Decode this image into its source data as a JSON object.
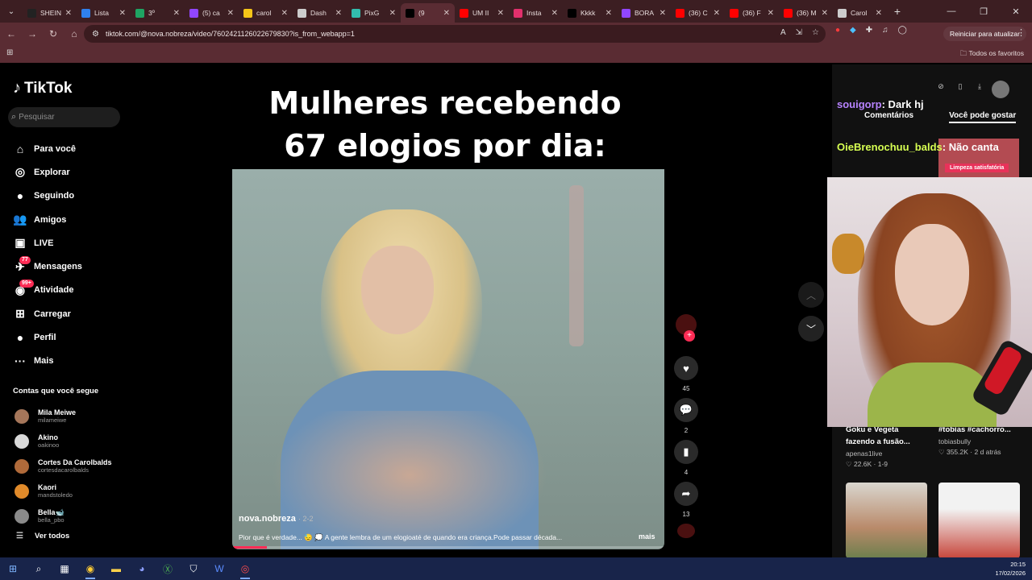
{
  "browser": {
    "tabs": [
      {
        "title": "SHEIN",
        "favicon": "S",
        "color": "#222222"
      },
      {
        "title": "Lista",
        "favicon": "cloud",
        "color": "#2f80ed"
      },
      {
        "title": "3º",
        "favicon": "drive",
        "color": "#1fa463"
      },
      {
        "title": "(5) ca",
        "favicon": "twitch",
        "color": "#9146ff"
      },
      {
        "title": "carol",
        "favicon": "c",
        "color": "#f5c518"
      },
      {
        "title": "Dash",
        "favicon": "globe",
        "color": "#cccccc"
      },
      {
        "title": "PixG",
        "favicon": "pix",
        "color": "#32bcad"
      },
      {
        "title": "(9",
        "favicon": "tiktok",
        "color": "#000000",
        "active": true
      },
      {
        "title": "UM II",
        "favicon": "youtube",
        "color": "#ff0000"
      },
      {
        "title": "Insta",
        "favicon": "instagram",
        "color": "#e1306c"
      },
      {
        "title": "Kkkk",
        "favicon": "tiktok",
        "color": "#000000"
      },
      {
        "title": "BORA",
        "favicon": "twitch",
        "color": "#9146ff"
      },
      {
        "title": "(36) C",
        "favicon": "youtube",
        "color": "#ff0000"
      },
      {
        "title": "(36) F",
        "favicon": "youtube",
        "color": "#ff0000"
      },
      {
        "title": "(36) M",
        "favicon": "youtube",
        "color": "#ff0000"
      },
      {
        "title": "Carol",
        "favicon": "globe",
        "color": "#cccccc"
      }
    ],
    "url": "tiktok.com/@nova.nobreza/video/7602421126022679830?is_from_webapp=1",
    "restart_label": "Reiniciar para atualizar",
    "all_favorites_label": "Todos os favoritos",
    "accent": "#5a2c33"
  },
  "tiktok": {
    "logo_text": "TikTok",
    "search_placeholder": "Pesquisar",
    "nav": [
      {
        "label": "Para você",
        "icon": "home-icon",
        "glyph": "⌂"
      },
      {
        "label": "Explorar",
        "icon": "compass-icon",
        "glyph": "◎"
      },
      {
        "label": "Seguindo",
        "icon": "following-avatar-icon",
        "glyph": "●"
      },
      {
        "label": "Amigos",
        "icon": "friends-icon",
        "glyph": "👥"
      },
      {
        "label": "LIVE",
        "icon": "live-icon",
        "glyph": "▣"
      },
      {
        "label": "Mensagens",
        "icon": "messages-icon",
        "glyph": "✈",
        "badge": "77"
      },
      {
        "label": "Atividade",
        "icon": "activity-icon",
        "glyph": "◉",
        "badge": "99+"
      },
      {
        "label": "Carregar",
        "icon": "upload-icon",
        "glyph": "⊞"
      },
      {
        "label": "Perfil",
        "icon": "profile-icon",
        "glyph": "●"
      },
      {
        "label": "Mais",
        "icon": "more-icon",
        "glyph": "···"
      }
    ],
    "following_title": "Contas que você segue",
    "following": [
      {
        "name": "Mila Meiwe",
        "handle": "milameiwe",
        "color": "#a5765a"
      },
      {
        "name": "Akino",
        "handle": "oakinoo",
        "color": "#d8d8d8"
      },
      {
        "name": "Cortes Da Carolbalds",
        "handle": "cortesdacarolbalds",
        "color": "#b06a3a"
      },
      {
        "name": "Kaori",
        "handle": "mandstoledo",
        "color": "#e08a2a"
      },
      {
        "name": "Bella🐋",
        "handle": "bella_pbo",
        "color": "#8a8a8a"
      }
    ],
    "see_all": "Ver todos",
    "video": {
      "overlay_text_line1": "Mulheres recebendo",
      "overlay_text_line2": "67 elogios por dia:",
      "author": "nova.nobreza",
      "date": "· 2-2",
      "description": "Pior que é verdade... 😓 💭 A gente lembra de um elogioaté de quando era criança.Pode passar década...",
      "more_label": "mais",
      "progress": 0.08
    },
    "actions": {
      "likes": "45",
      "comments": "2",
      "saves": "4",
      "shares": "13"
    }
  },
  "right_panel": {
    "chat": [
      {
        "user": "souigorp",
        "message": ": Dark hj"
      },
      {
        "user": "OieBrenochuu_balds",
        "message": ": Não canta"
      }
    ],
    "tabs": [
      "Comentários",
      "Você pode gostar"
    ],
    "thumb_tag": "Limpeza satisfatória",
    "recommendations": [
      {
        "title": "Goku e Vegeta fazendo a fusão...",
        "author": "apenas1live",
        "stats": "♡ 22.6K · 1-9"
      },
      {
        "title": "#tobias #cachorro...",
        "author": "tobiasbully",
        "stats": "♡ 355.2K · 2 d atrás"
      }
    ]
  },
  "taskbar": {
    "time": "20:15",
    "date": "17/02/2026"
  }
}
